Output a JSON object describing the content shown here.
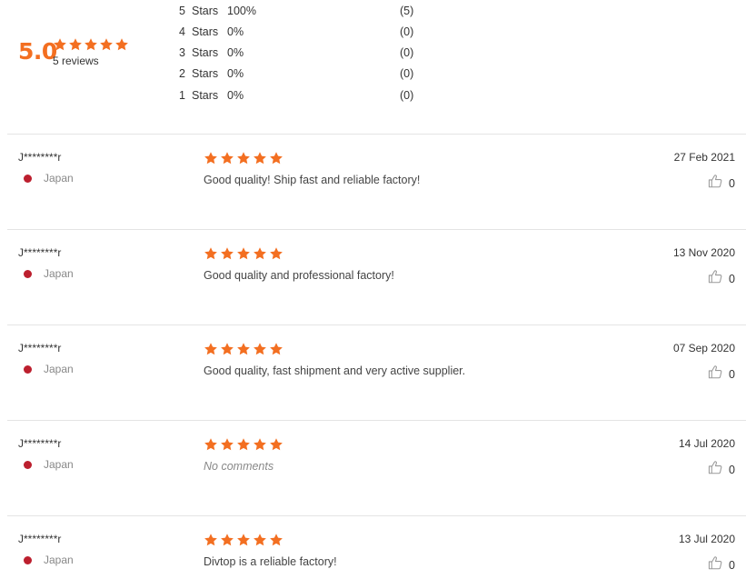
{
  "summary": {
    "average": "5.0",
    "stars": 5,
    "reviews_text": "5 reviews",
    "distribution": [
      {
        "num": "5",
        "label": "Stars",
        "pct": "100%",
        "count": "(5)"
      },
      {
        "num": "4",
        "label": "Stars",
        "pct": "0%",
        "count": "(0)"
      },
      {
        "num": "3",
        "label": "Stars",
        "pct": "0%",
        "count": "(0)"
      },
      {
        "num": "2",
        "label": "Stars",
        "pct": "0%",
        "count": "(0)"
      },
      {
        "num": "1",
        "label": "Stars",
        "pct": "0%",
        "count": "(0)"
      }
    ]
  },
  "colors": {
    "star": "#f36f21",
    "flag": "#bc1f2e"
  },
  "icons": {
    "rating": "star-icon",
    "country": "japan-flag-icon",
    "like": "thumbs-up-icon"
  },
  "reviews": [
    {
      "reviewer": "J********r",
      "country": "Japan",
      "rating": 5,
      "comment": "Good quality! Ship fast and reliable factory!",
      "date": "27 Feb 2021",
      "likes": "0"
    },
    {
      "reviewer": "J********r",
      "country": "Japan",
      "rating": 5,
      "comment": "Good quality and professional factory!",
      "date": "13 Nov 2020",
      "likes": "0"
    },
    {
      "reviewer": "J********r",
      "country": "Japan",
      "rating": 5,
      "comment": "Good quality, fast shipment and very active supplier.",
      "date": "07 Sep 2020",
      "likes": "0"
    },
    {
      "reviewer": "J********r",
      "country": "Japan",
      "rating": 5,
      "comment": "No comments",
      "date": "14 Jul 2020",
      "likes": "0"
    },
    {
      "reviewer": "J********r",
      "country": "Japan",
      "rating": 5,
      "comment": "Divtop is a reliable factory!",
      "date": "13 Jul 2020",
      "likes": "0"
    }
  ]
}
